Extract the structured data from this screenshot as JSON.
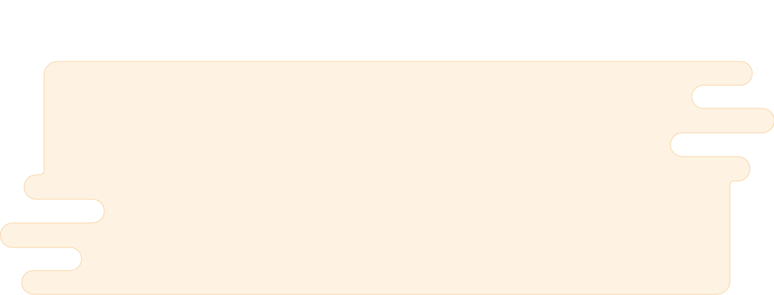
{
  "shape": {
    "fill": "#fef3e2",
    "stroke": "#f7d3a2"
  }
}
